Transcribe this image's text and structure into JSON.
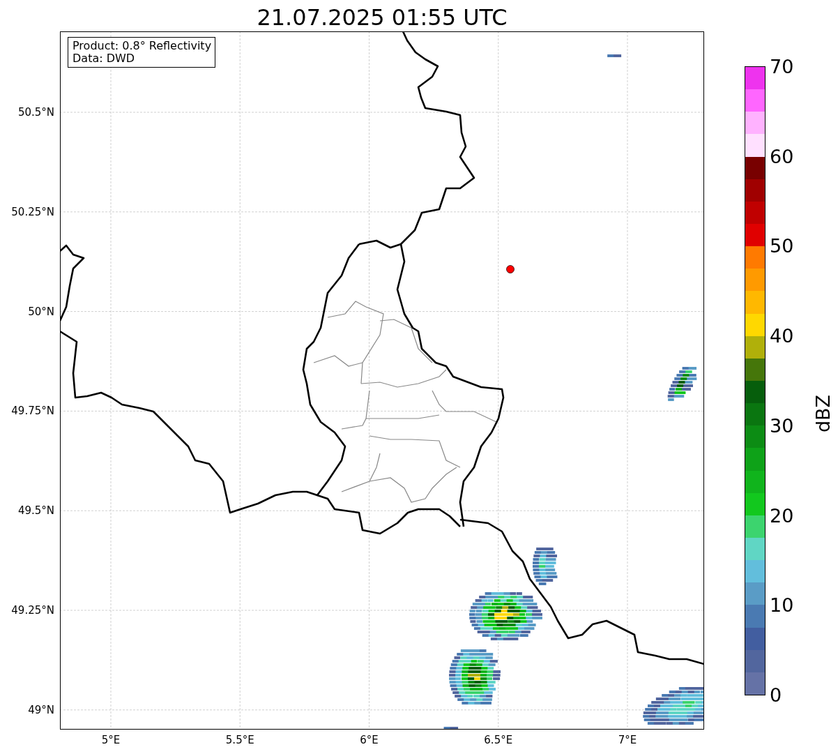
{
  "title": "21.07.2025 01:55 UTC",
  "legend": {
    "lines": [
      "Product: 0.8° Reflectivity",
      "Data: DWD"
    ]
  },
  "map": {
    "lat_ticks": [
      "50.5°N",
      "50.25°N",
      "50°N",
      "49.75°N",
      "49.5°N",
      "49.25°N",
      "49°N"
    ],
    "lon_ticks": [
      "5°E",
      "5.5°E",
      "6°E",
      "6.5°E",
      "7°E"
    ]
  },
  "colorbar": {
    "label": "dBZ",
    "ticks": [
      "70",
      "60",
      "50",
      "40",
      "30",
      "20",
      "10",
      "0"
    ],
    "bands": [
      {
        "color": "#6572a6"
      },
      {
        "color": "#52669e"
      },
      {
        "color": "#425ea0"
      },
      {
        "color": "#4a7ab2"
      },
      {
        "color": "#5a9cc6"
      },
      {
        "color": "#62bedc"
      },
      {
        "color": "#60d6c4"
      },
      {
        "color": "#3cd46e"
      },
      {
        "color": "#12c81e"
      },
      {
        "color": "#10b41c"
      },
      {
        "color": "#0ea218"
      },
      {
        "color": "#0c8c14"
      },
      {
        "color": "#0a7610"
      },
      {
        "color": "#065e0c"
      },
      {
        "color": "#45760a"
      },
      {
        "color": "#b0b00a"
      },
      {
        "color": "#ffd800"
      },
      {
        "color": "#ffb800"
      },
      {
        "color": "#ff9a00"
      },
      {
        "color": "#ff7a00"
      },
      {
        "color": "#e00000"
      },
      {
        "color": "#c00000"
      },
      {
        "color": "#a00000"
      },
      {
        "color": "#780000"
      },
      {
        "color": "#ffe0ff"
      },
      {
        "color": "#ffb2ff"
      },
      {
        "color": "#ff66ff"
      },
      {
        "color": "#ee33ee"
      }
    ]
  }
}
